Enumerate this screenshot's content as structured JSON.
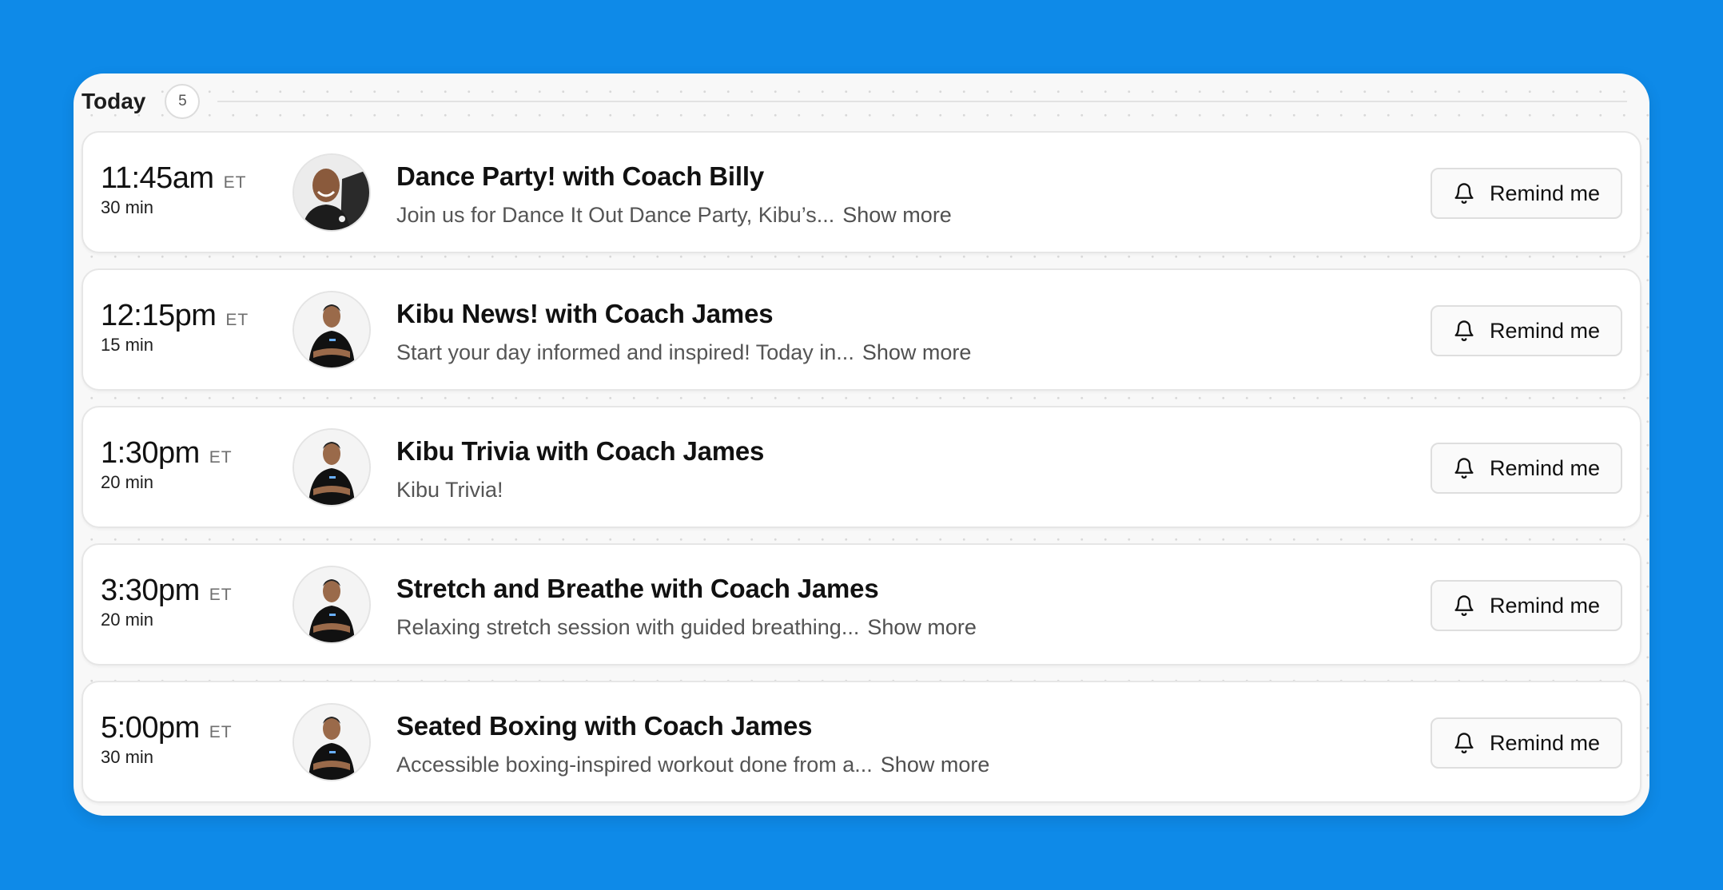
{
  "header": {
    "title": "Today",
    "count": "5"
  },
  "sessions": [
    {
      "time": "11:45am",
      "tz": "ET",
      "duration": "30 min",
      "coach_avatar": "coach-billy-avatar",
      "title": "Dance Party! with Coach Billy",
      "description": "Join us for Dance It Out Dance Party, Kibu’s...",
      "show_more": "Show more",
      "remind_label": "Remind me"
    },
    {
      "time": "12:15pm",
      "tz": "ET",
      "duration": "15 min",
      "coach_avatar": "coach-james-avatar",
      "title": "Kibu News! with Coach James",
      "description": "Start your day informed and inspired! Today in...",
      "show_more": "Show more",
      "remind_label": "Remind me"
    },
    {
      "time": "1:30pm",
      "tz": "ET",
      "duration": "20 min",
      "coach_avatar": "coach-james-avatar",
      "title": "Kibu Trivia with Coach James",
      "description": "Kibu Trivia!",
      "show_more": "",
      "remind_label": "Remind me"
    },
    {
      "time": "3:30pm",
      "tz": "ET",
      "duration": "20 min",
      "coach_avatar": "coach-james-avatar",
      "title": "Stretch and Breathe with Coach James",
      "description": "Relaxing stretch session with guided breathing...",
      "show_more": "Show more",
      "remind_label": "Remind me"
    },
    {
      "time": "5:00pm",
      "tz": "ET",
      "duration": "30 min",
      "coach_avatar": "coach-james-avatar",
      "title": "Seated Boxing with Coach James",
      "description": "Accessible boxing-inspired workout done from a...",
      "show_more": "Show more",
      "remind_label": "Remind me"
    }
  ],
  "colors": {
    "background": "#0e8ae8",
    "card": "#f8f8f8",
    "row": "#ffffff"
  }
}
